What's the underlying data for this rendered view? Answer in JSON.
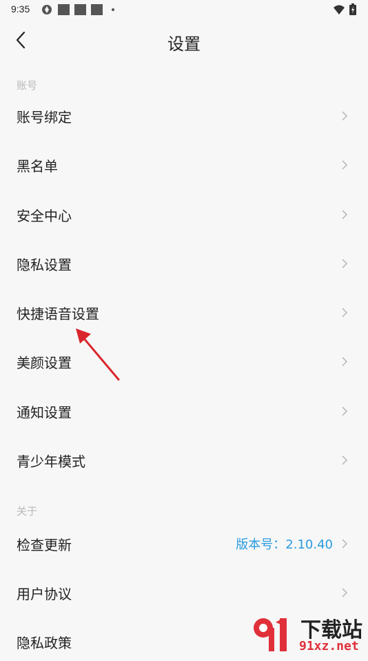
{
  "status_bar": {
    "time": "9:35"
  },
  "header": {
    "title": "设置"
  },
  "sections": {
    "account": {
      "label": "账号",
      "items": [
        {
          "label": "账号绑定"
        },
        {
          "label": "黑名单"
        },
        {
          "label": "安全中心"
        },
        {
          "label": "隐私设置"
        },
        {
          "label": "快捷语音设置"
        },
        {
          "label": "美颜设置"
        },
        {
          "label": "通知设置"
        },
        {
          "label": "青少年模式"
        }
      ]
    },
    "about": {
      "label": "关于",
      "items": [
        {
          "label": "检查更新",
          "value": "版本号：2.10.40"
        },
        {
          "label": "用户协议"
        },
        {
          "label": "隐私政策"
        }
      ]
    }
  },
  "watermark": {
    "top": "下载站",
    "bottom": "91xz.net"
  },
  "colors": {
    "accent": "#2a9bde",
    "arrow": "#d9262c",
    "watermark_red": "#e0303a"
  }
}
